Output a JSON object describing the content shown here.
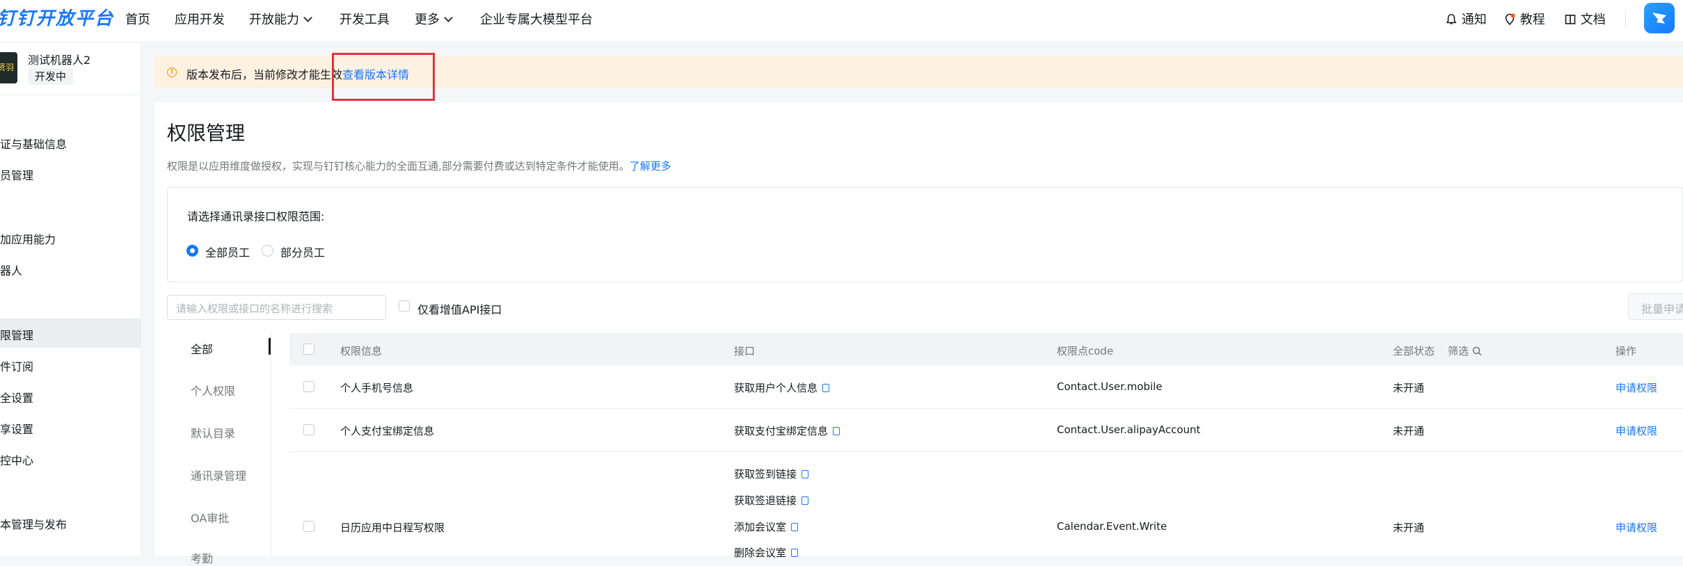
{
  "topnav": {
    "logo": "钉钉开放平台",
    "items": [
      {
        "label": "首页"
      },
      {
        "label": "应用开发"
      },
      {
        "label": "开放能力"
      },
      {
        "label": "开发工具"
      },
      {
        "label": "更多"
      },
      {
        "label": "企业专属大模型平台"
      }
    ],
    "notify": "通知",
    "tutorial": "教程",
    "docs": "文档"
  },
  "sidebar": {
    "app_name": "测试机器人2",
    "app_status": "开发中",
    "items": [
      {
        "label": "证与基础信息"
      },
      {
        "label": "员管理"
      },
      {
        "label": "加应用能力"
      },
      {
        "label": "器人"
      },
      {
        "label": "限管理"
      },
      {
        "label": "件订阅"
      },
      {
        "label": "全设置"
      },
      {
        "label": "享设置"
      },
      {
        "label": "控中心"
      },
      {
        "label": "本管理与发布"
      }
    ]
  },
  "banner": {
    "text": "版本发布后，当前修改才能生效",
    "link": "查看版本详情"
  },
  "main": {
    "title": "权限管理",
    "description": "权限是以应用维度做授权，实现与钉钉核心能力的全面互通,部分需要付费或达到特定条件才能使用。",
    "description_link": "了解更多",
    "scope_label": "请选择通讯录接口权限范围:",
    "scope_options": [
      "全部员工",
      "部分员工"
    ],
    "search_placeholder": "请输入权限或接口的名称进行搜索",
    "only_paid_label": "仅看增值API接口",
    "batch_button": "批量申请",
    "categories": [
      "全部",
      "个人权限",
      "默认目录",
      "通讯录管理",
      "OA审批",
      "考勤"
    ]
  },
  "table": {
    "headers": {
      "perm_info": "权限信息",
      "api": "接口",
      "code": "权限点code",
      "status": "全部状态",
      "filter": "筛选",
      "action": "操作"
    },
    "rows": [
      {
        "name": "个人手机号信息",
        "apis": [
          "获取用户个人信息"
        ],
        "code": "Contact.User.mobile",
        "status": "未开通",
        "action": "申请权限"
      },
      {
        "name": "个人支付宝绑定信息",
        "apis": [
          "获取支付宝绑定信息"
        ],
        "code": "Contact.User.alipayAccount",
        "status": "未开通",
        "action": "申请权限"
      },
      {
        "name": "日历应用中日程写权限",
        "apis": [
          "获取签到链接",
          "获取签退链接",
          "添加会议室",
          "删除会议室"
        ],
        "code": "Calendar.Event.Write",
        "status": "未开通",
        "action": "申请权限"
      }
    ]
  }
}
